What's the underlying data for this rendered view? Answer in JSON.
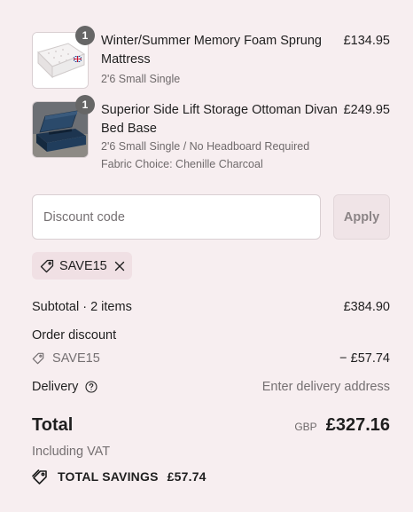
{
  "items": [
    {
      "quantity": "1",
      "title": "Winter/Summer Memory Foam Sprung Mattress",
      "price": "£134.95",
      "meta": [
        "2'6 Small Single"
      ],
      "image_icon": "mattress-image"
    },
    {
      "quantity": "1",
      "title": "Superior Side Lift Storage Ottoman Divan Bed Base",
      "price": "£249.95",
      "meta": [
        "2'6 Small Single / No Headboard Required",
        "Fabric Choice: Chenille Charcoal"
      ],
      "image_icon": "ottoman-bed-image"
    }
  ],
  "discount": {
    "placeholder": "Discount code",
    "apply_label": "Apply",
    "applied_code": "SAVE15"
  },
  "summary": {
    "subtotal_label": "Subtotal · 2 items",
    "subtotal_value": "£384.90",
    "order_discount_label": "Order discount",
    "discount_code": "SAVE15",
    "discount_value": "− £57.74",
    "delivery_label": "Delivery",
    "delivery_value": "Enter delivery address",
    "total_label": "Total",
    "total_currency": "GBP",
    "total_value": "£327.16",
    "vat_note": "Including VAT",
    "savings_label": "TOTAL SAVINGS",
    "savings_value": "£57.74"
  },
  "colors": {
    "background": "#f7eef0",
    "chip": "#f0e0e4",
    "qty_badge": "#666666"
  }
}
